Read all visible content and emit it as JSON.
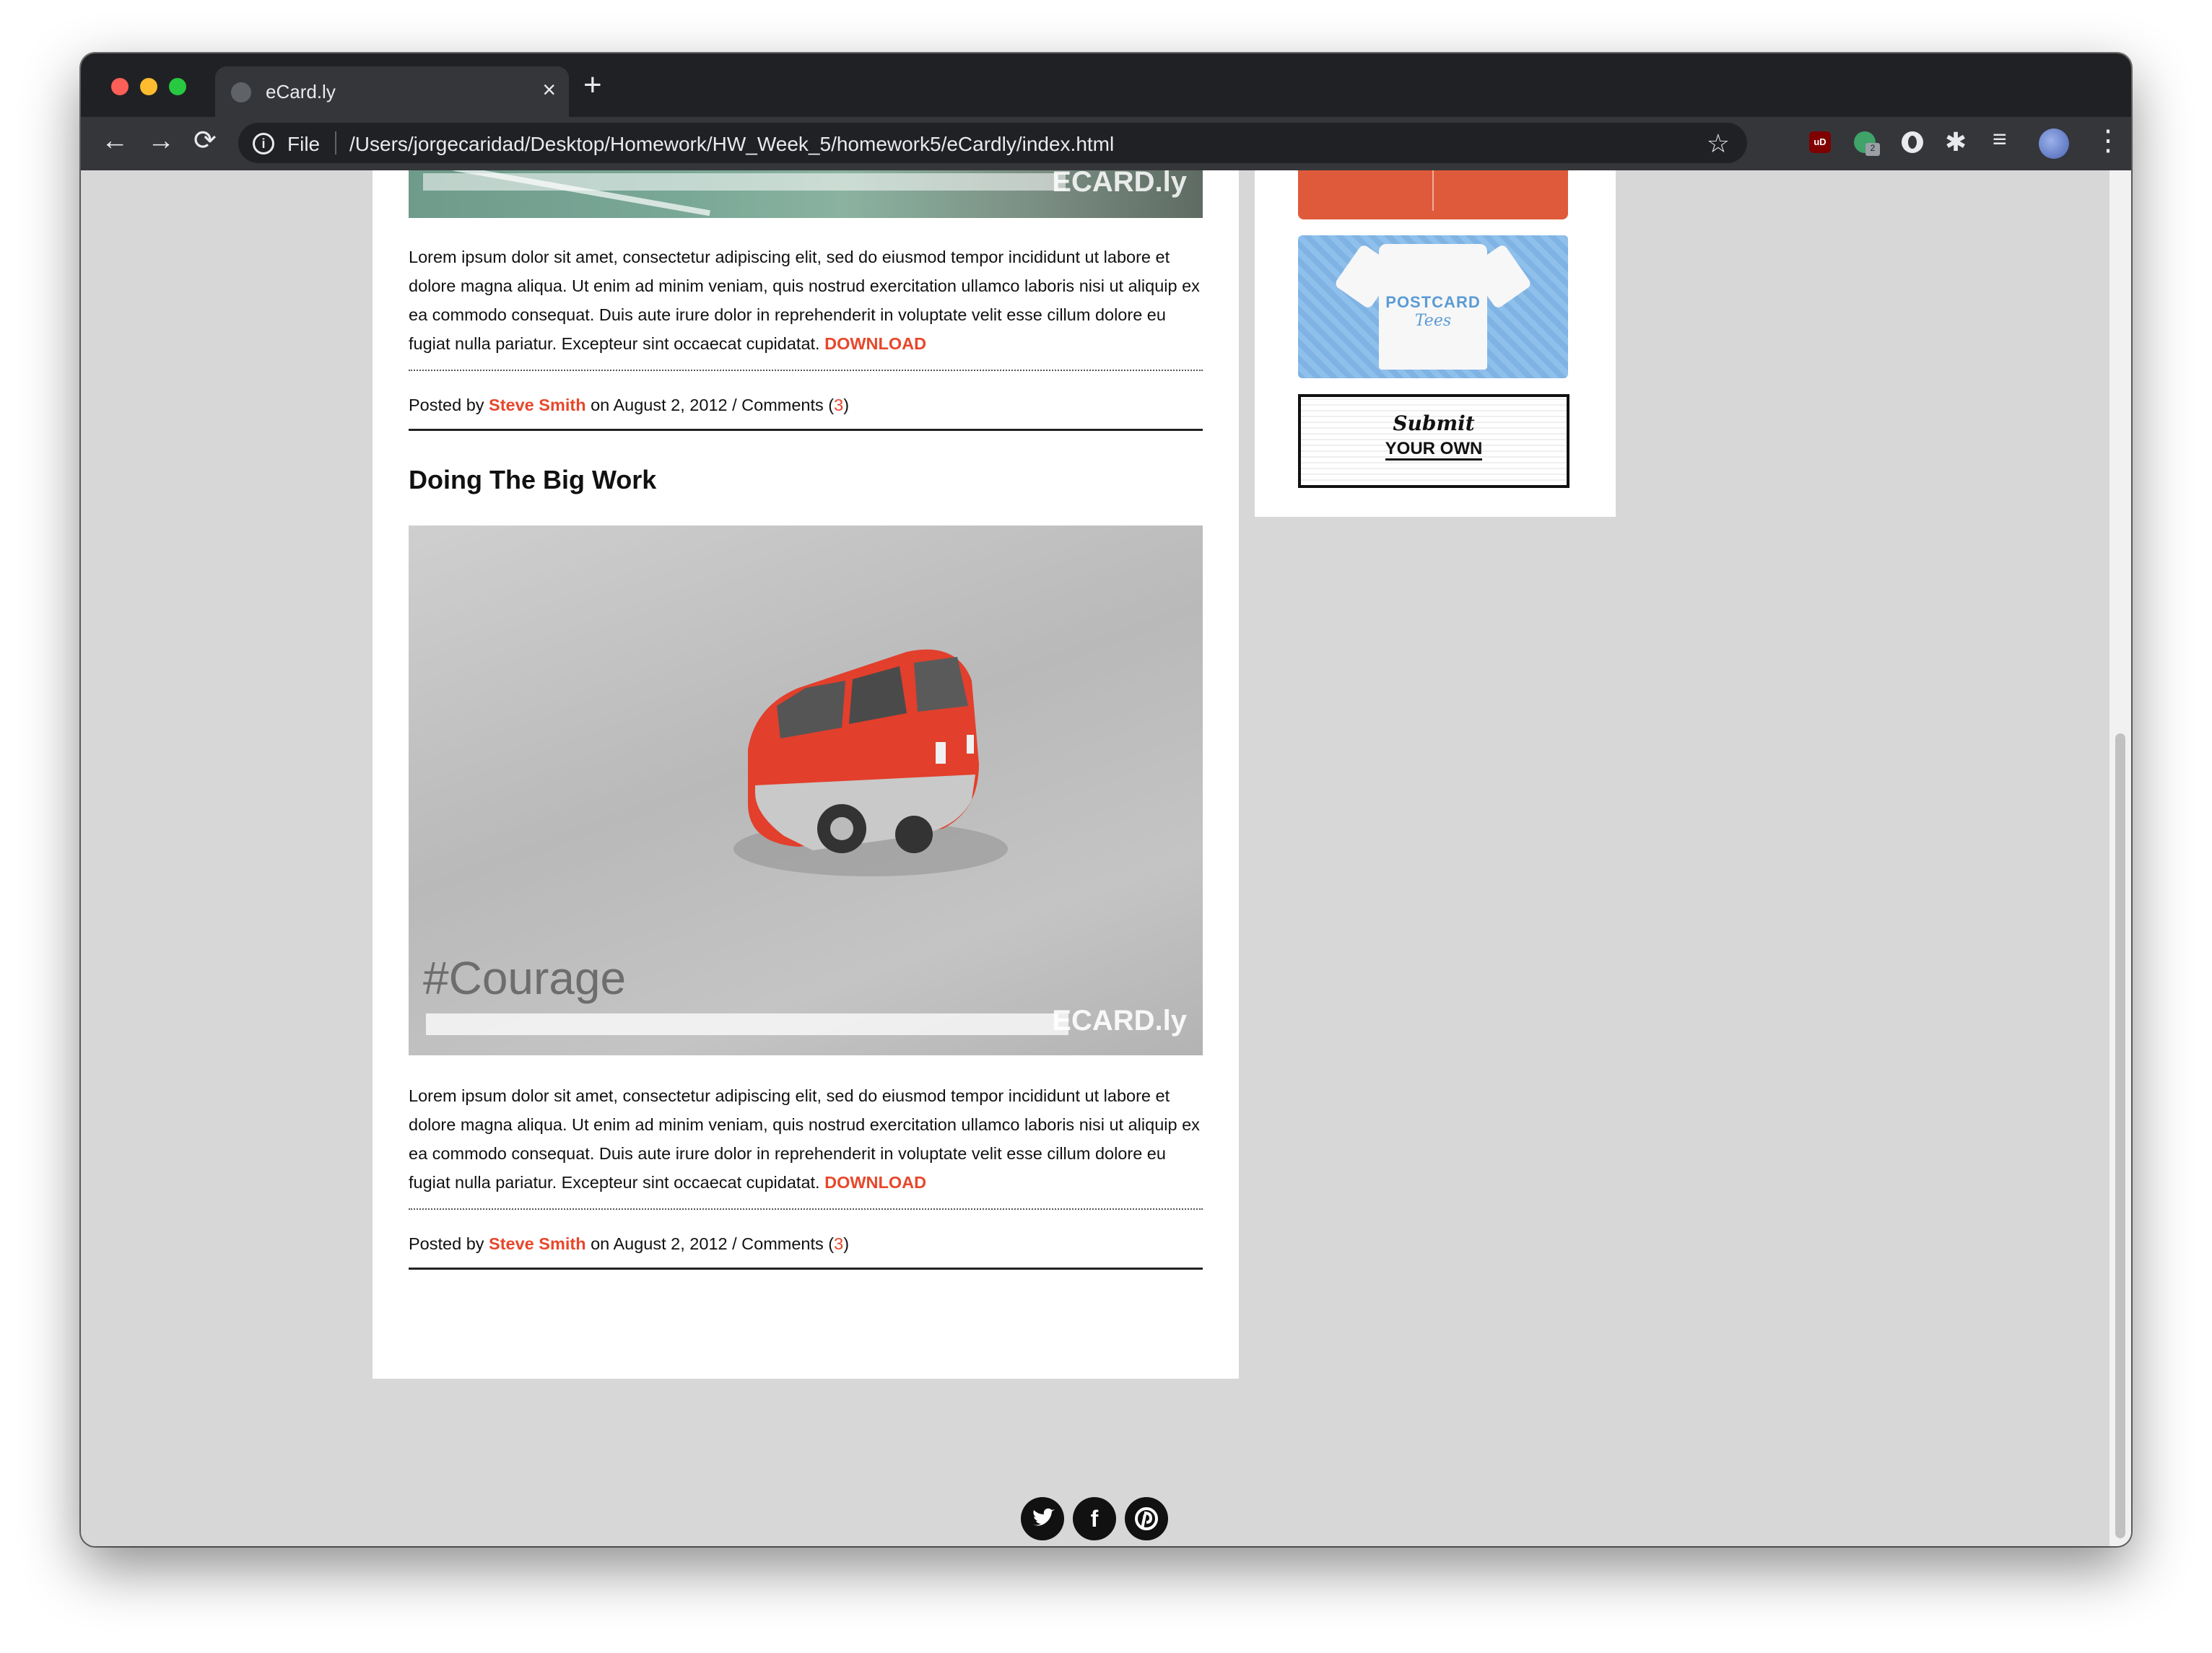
{
  "browser": {
    "tab_title": "eCard.ly",
    "tab_close": "×",
    "new_tab": "+",
    "back_icon": "←",
    "forward_icon": "→",
    "reload_icon": "⟳",
    "scheme": "File",
    "url": "/Users/jorgecaridad/Desktop/Homework/HW_Week_5/homework5/eCardly/index.html",
    "star_icon": "☆",
    "ext_ub": "uD",
    "ext_badge": "2",
    "puzzle_icon": "✱",
    "list_icon": "≡",
    "menu_icon": "⋮"
  },
  "posts": [
    {
      "image_watermark": "ECARD.ly",
      "body": "Lorem ipsum dolor sit amet, consectetur adipiscing elit, sed do eiusmod tempor incididunt ut labore et dolore magna aliqua. Ut enim ad minim veniam, quis nostrud exercitation ullamco laboris nisi ut aliquip ex ea commodo consequat. Duis aute irure dolor in reprehenderit in voluptate velit esse cillum dolore eu fugiat nulla pariatur. Excepteur sint occaecat cupidatat.",
      "download": "DOWNLOAD",
      "meta_prefix": "Posted by",
      "author": "Steve Smith",
      "meta_date": "on August 2, 2012 / Comments (",
      "comment_count": "3",
      "meta_suffix": ")"
    },
    {
      "title": "Doing The Big Work",
      "image_hashtag": "#Courage",
      "image_watermark": "ECARD.ly",
      "body": "Lorem ipsum dolor sit amet, consectetur adipiscing elit, sed do eiusmod tempor incididunt ut labore et dolore magna aliqua. Ut enim ad minim veniam, quis nostrud exercitation ullamco laboris nisi ut aliquip ex ea commodo consequat. Duis aute irure dolor in reprehenderit in voluptate velit esse cillum dolore eu fugiat nulla pariatur. Excepteur sint occaecat cupidatat.",
      "download": "DOWNLOAD",
      "meta_prefix": "Posted by",
      "author": "Steve Smith",
      "meta_date": "on August 2, 2012 / Comments (",
      "comment_count": "3",
      "meta_suffix": ")"
    }
  ],
  "sidebar": {
    "tees_line1": "POSTCARD",
    "tees_line2": "Tees",
    "submit_line1": "Submit",
    "submit_line2": "YOUR OWN"
  },
  "footer": {
    "social": [
      {
        "name": "twitter-icon",
        "glyph": "🐦"
      },
      {
        "name": "facebook-icon",
        "glyph": "f"
      },
      {
        "name": "pinterest-icon",
        "glyph": "P"
      }
    ]
  },
  "colors": {
    "accent": "#e8472b",
    "page_bg": "#d7d7d7",
    "chrome_dark": "#202124",
    "chrome_toolbar": "#35363a"
  }
}
